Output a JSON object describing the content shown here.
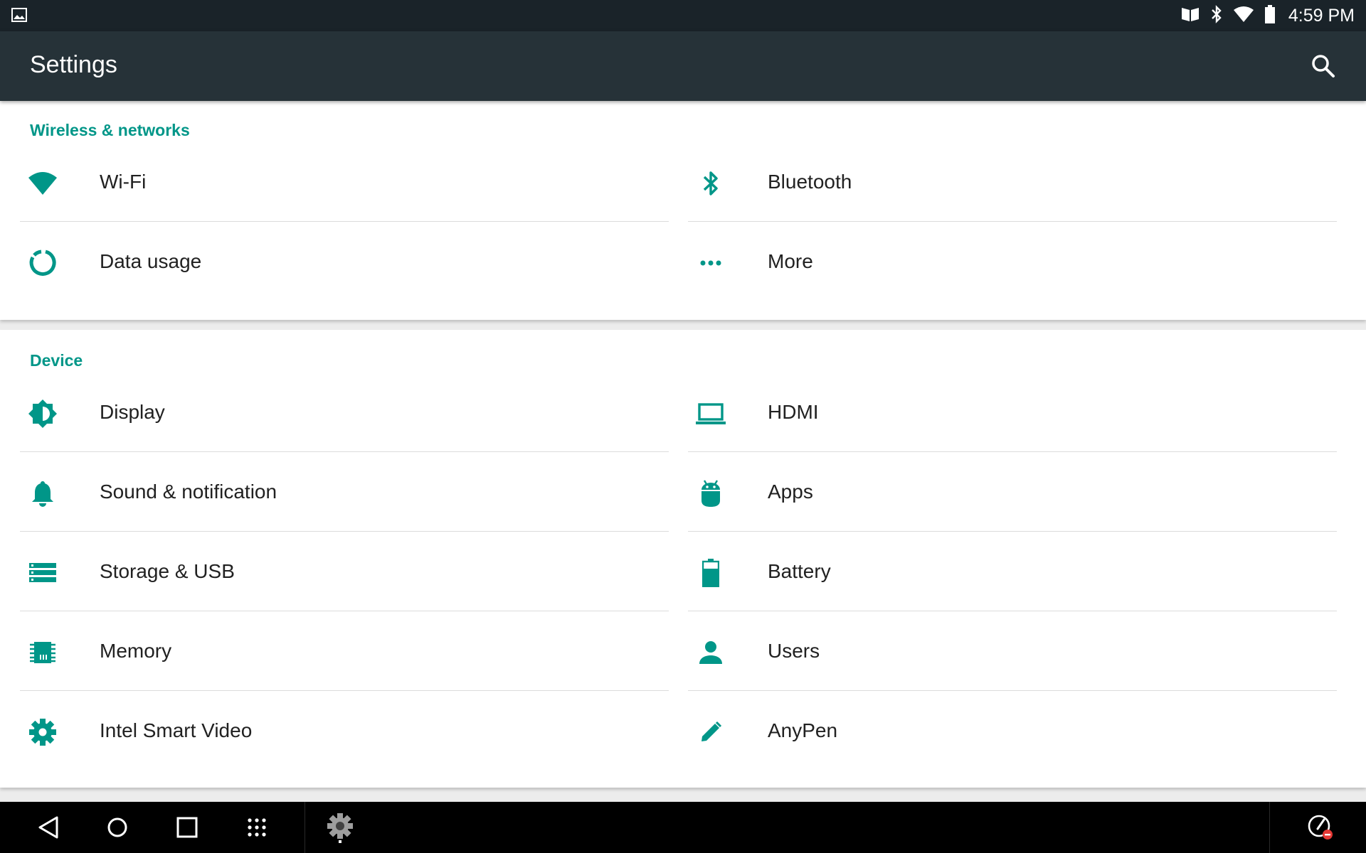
{
  "status_bar": {
    "time": "4:59 PM",
    "icons": [
      "image-icon",
      "book-icon",
      "bluetooth-icon",
      "wifi-icon",
      "battery-icon"
    ]
  },
  "app_bar": {
    "title": "Settings",
    "search_icon": "search-icon"
  },
  "sections": [
    {
      "title": "Wireless & networks",
      "items": [
        {
          "label": "Wi-Fi",
          "icon": "wifi-icon"
        },
        {
          "label": "Bluetooth",
          "icon": "bluetooth-icon"
        },
        {
          "label": "Data usage",
          "icon": "data-usage-icon"
        },
        {
          "label": "More",
          "icon": "more-icon"
        }
      ]
    },
    {
      "title": "Device",
      "items": [
        {
          "label": "Display",
          "icon": "brightness-icon"
        },
        {
          "label": "HDMI",
          "icon": "laptop-icon"
        },
        {
          "label": "Sound & notification",
          "icon": "bell-icon"
        },
        {
          "label": "Apps",
          "icon": "android-icon"
        },
        {
          "label": "Storage & USB",
          "icon": "storage-icon"
        },
        {
          "label": "Battery",
          "icon": "battery-icon"
        },
        {
          "label": "Memory",
          "icon": "memory-icon"
        },
        {
          "label": "Users",
          "icon": "person-icon"
        },
        {
          "label": "Intel Smart Video",
          "icon": "gear-icon"
        },
        {
          "label": "AnyPen",
          "icon": "pencil-icon"
        }
      ]
    }
  ],
  "nav_bar": {
    "buttons": [
      "back-icon",
      "home-icon",
      "recents-icon",
      "app-grid-icon",
      "settings-app-icon",
      "speedometer-icon"
    ]
  },
  "colors": {
    "accent": "#009688",
    "app_bar": "#263238",
    "status_bar": "#1a2329",
    "text": "#212121"
  }
}
